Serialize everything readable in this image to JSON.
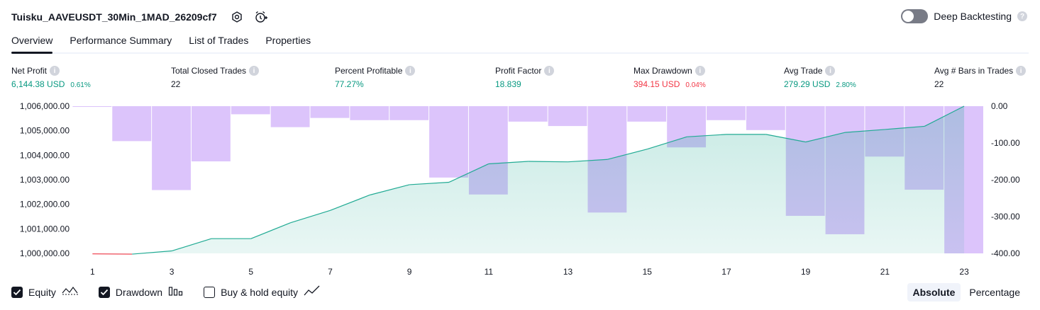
{
  "header": {
    "title": "Tuisku_AAVEUSDT_30Min_1MAD_26209cf7",
    "deep_backtesting_label": "Deep Backtesting",
    "deep_backtesting_on": false
  },
  "tabs": [
    {
      "label": "Overview",
      "active": true
    },
    {
      "label": "Performance Summary",
      "active": false
    },
    {
      "label": "List of Trades",
      "active": false
    },
    {
      "label": "Properties",
      "active": false
    }
  ],
  "metrics": {
    "net_profit": {
      "label": "Net Profit",
      "value": "6,144.38 USD",
      "pct": "0.61%"
    },
    "total_closed_trades": {
      "label": "Total Closed Trades",
      "value": "22"
    },
    "percent_profitable": {
      "label": "Percent Profitable",
      "value": "77.27%"
    },
    "profit_factor": {
      "label": "Profit Factor",
      "value": "18.839"
    },
    "max_drawdown": {
      "label": "Max Drawdown",
      "value": "394.15 USD",
      "pct": "0.04%"
    },
    "avg_trade": {
      "label": "Avg Trade",
      "value": "279.29 USD",
      "pct": "2.80%"
    },
    "avg_bars": {
      "label": "Avg # Bars in Trades",
      "value": "22"
    }
  },
  "colors": {
    "equity_line": "#22ab94",
    "equity_fill": "#d5f0e8",
    "equity_negative": "#f23645",
    "drawdown_bar": "#dcc4fb",
    "drawdown_overlap": "#b3afe6",
    "profit_green": "#089981",
    "loss_red": "#f23645"
  },
  "legend": {
    "equity": {
      "label": "Equity",
      "checked": true
    },
    "drawdown": {
      "label": "Drawdown",
      "checked": true
    },
    "buy_hold": {
      "label": "Buy & hold equity",
      "checked": false
    }
  },
  "modes": {
    "absolute": "Absolute",
    "percentage": "Percentage",
    "selected": "Absolute"
  },
  "chart_data": {
    "type": "line",
    "x_ticks": [
      1,
      3,
      5,
      7,
      9,
      11,
      13,
      15,
      17,
      19,
      21,
      23
    ],
    "y_left_ticks": [
      "1,000,000.00",
      "1,001,000.00",
      "1,002,000.00",
      "1,003,000.00",
      "1,004,000.00",
      "1,005,000.00",
      "1,006,000.00"
    ],
    "y_right_ticks": [
      "0.00",
      "-100.00",
      "-200.00",
      "-300.00",
      "-400.00"
    ],
    "y_left_range": [
      1000000,
      1006000
    ],
    "y_right_range": [
      -400,
      0
    ],
    "x_range": [
      0.6,
      23.5
    ],
    "series": [
      {
        "name": "Equity",
        "axis": "left",
        "x": [
          1,
          2,
          3,
          4,
          5,
          6,
          7,
          8,
          9,
          10,
          11,
          12,
          13,
          14,
          15,
          16,
          17,
          18,
          19,
          20,
          21,
          22,
          23
        ],
        "values": [
          999980,
          999970,
          1000100,
          1000600,
          1000600,
          1001250,
          1001750,
          1002380,
          1002800,
          1002900,
          1003650,
          1003750,
          1003730,
          1003830,
          1004250,
          1004750,
          1004850,
          1004850,
          1004540,
          1004930,
          1005050,
          1005180,
          1006100
        ]
      },
      {
        "name": "Drawdown",
        "axis": "right",
        "type": "bar",
        "x": [
          1,
          2,
          3,
          4,
          5,
          6,
          7,
          8,
          9,
          10,
          11,
          12,
          13,
          14,
          15,
          16,
          17,
          18,
          19,
          20,
          21,
          22,
          23
        ],
        "values": [
          -2,
          -95,
          -228,
          -150,
          -22,
          -57,
          -32,
          -38,
          -38,
          -194,
          -240,
          -42,
          -54,
          -289,
          -42,
          -112,
          -38,
          -65,
          -298,
          -348,
          -137,
          -227,
          -400
        ]
      }
    ],
    "grid": false,
    "legend_position": "bottom-left"
  }
}
